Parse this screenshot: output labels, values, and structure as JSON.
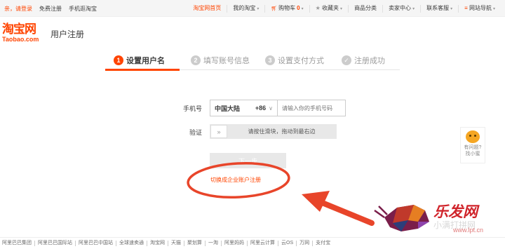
{
  "topbar": {
    "greeting": "亲，请登录",
    "register": "免费注册",
    "mobile": "手机逛淘宝",
    "right": [
      {
        "label": "淘宝网首页",
        "caret": false
      },
      {
        "label": "我的淘宝",
        "caret": true
      },
      {
        "label": "购物车",
        "badge": "0",
        "caret": true
      },
      {
        "label": "收藏夹",
        "caret": true
      },
      {
        "label": "商品分类",
        "caret": false
      },
      {
        "label": "卖家中心",
        "caret": true
      },
      {
        "label": "联系客服",
        "caret": true
      },
      {
        "label": "网站导航",
        "caret": true
      }
    ]
  },
  "header": {
    "logo_cn": "淘宝网",
    "logo_en": "Taobao.com",
    "title": "用户注册"
  },
  "steps": [
    {
      "num": "1",
      "label": "设置用户名",
      "active": true
    },
    {
      "num": "2",
      "label": "填写账号信息",
      "active": false
    },
    {
      "num": "3",
      "label": "设置支付方式",
      "active": false
    },
    {
      "num": "✓",
      "label": "注册成功",
      "active": false
    }
  ],
  "form": {
    "phone_label": "手机号",
    "country": "中国大陆",
    "country_code": "+86",
    "phone_placeholder": "请输入你的手机号码",
    "verify_label": "验证",
    "slider_handle": "»",
    "slider_text": "请按住滑块，拖动到最右边",
    "next": "下一步",
    "enterprise_link": "切换成企业账户注册"
  },
  "help": {
    "line1": "有问题?",
    "line2": "找小蜜"
  },
  "footer": [
    "阿里巴巴集团",
    "阿里巴巴国际站",
    "阿里巴巴中国站",
    "全球速卖通",
    "淘宝网",
    "天猫",
    "聚划算",
    "一淘",
    "阿里妈妈",
    "阿里云计算",
    "云OS",
    "万网",
    "支付宝"
  ],
  "watermark": {
    "brand": "乐发网",
    "sub": "小满打拼网",
    "url": "www.lpt.cn"
  },
  "colors": {
    "accent": "#ff4400",
    "annotation": "#e8452a"
  }
}
